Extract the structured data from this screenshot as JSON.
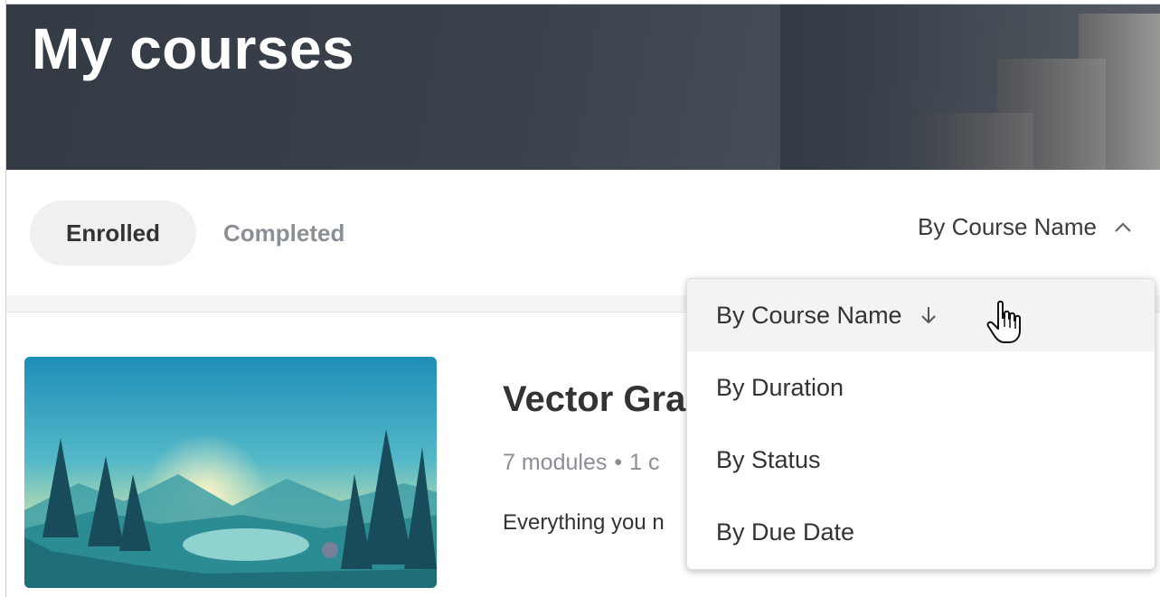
{
  "header": {
    "title": "My courses"
  },
  "tabs": [
    {
      "label": "Enrolled",
      "active": true
    },
    {
      "label": "Completed",
      "active": false
    }
  ],
  "sort": {
    "current_label": "By Course Name",
    "toggle_icon": "chevron-up-icon",
    "options": [
      {
        "label": "By Course Name",
        "selected": true,
        "icon": "arrow-down-icon"
      },
      {
        "label": "By Duration"
      },
      {
        "label": "By Status"
      },
      {
        "label": "By Due Date"
      }
    ]
  },
  "course": {
    "title": "Vector Gra",
    "modules": "7 modules",
    "separator": "•",
    "meta_extra": "1 c",
    "description": "Everything you n"
  },
  "colors": {
    "banner": "#333a44",
    "active_tab_bg": "#f0f0f0",
    "inactive_tab_text": "#8a9096",
    "meta_text": "#8a8f95"
  }
}
